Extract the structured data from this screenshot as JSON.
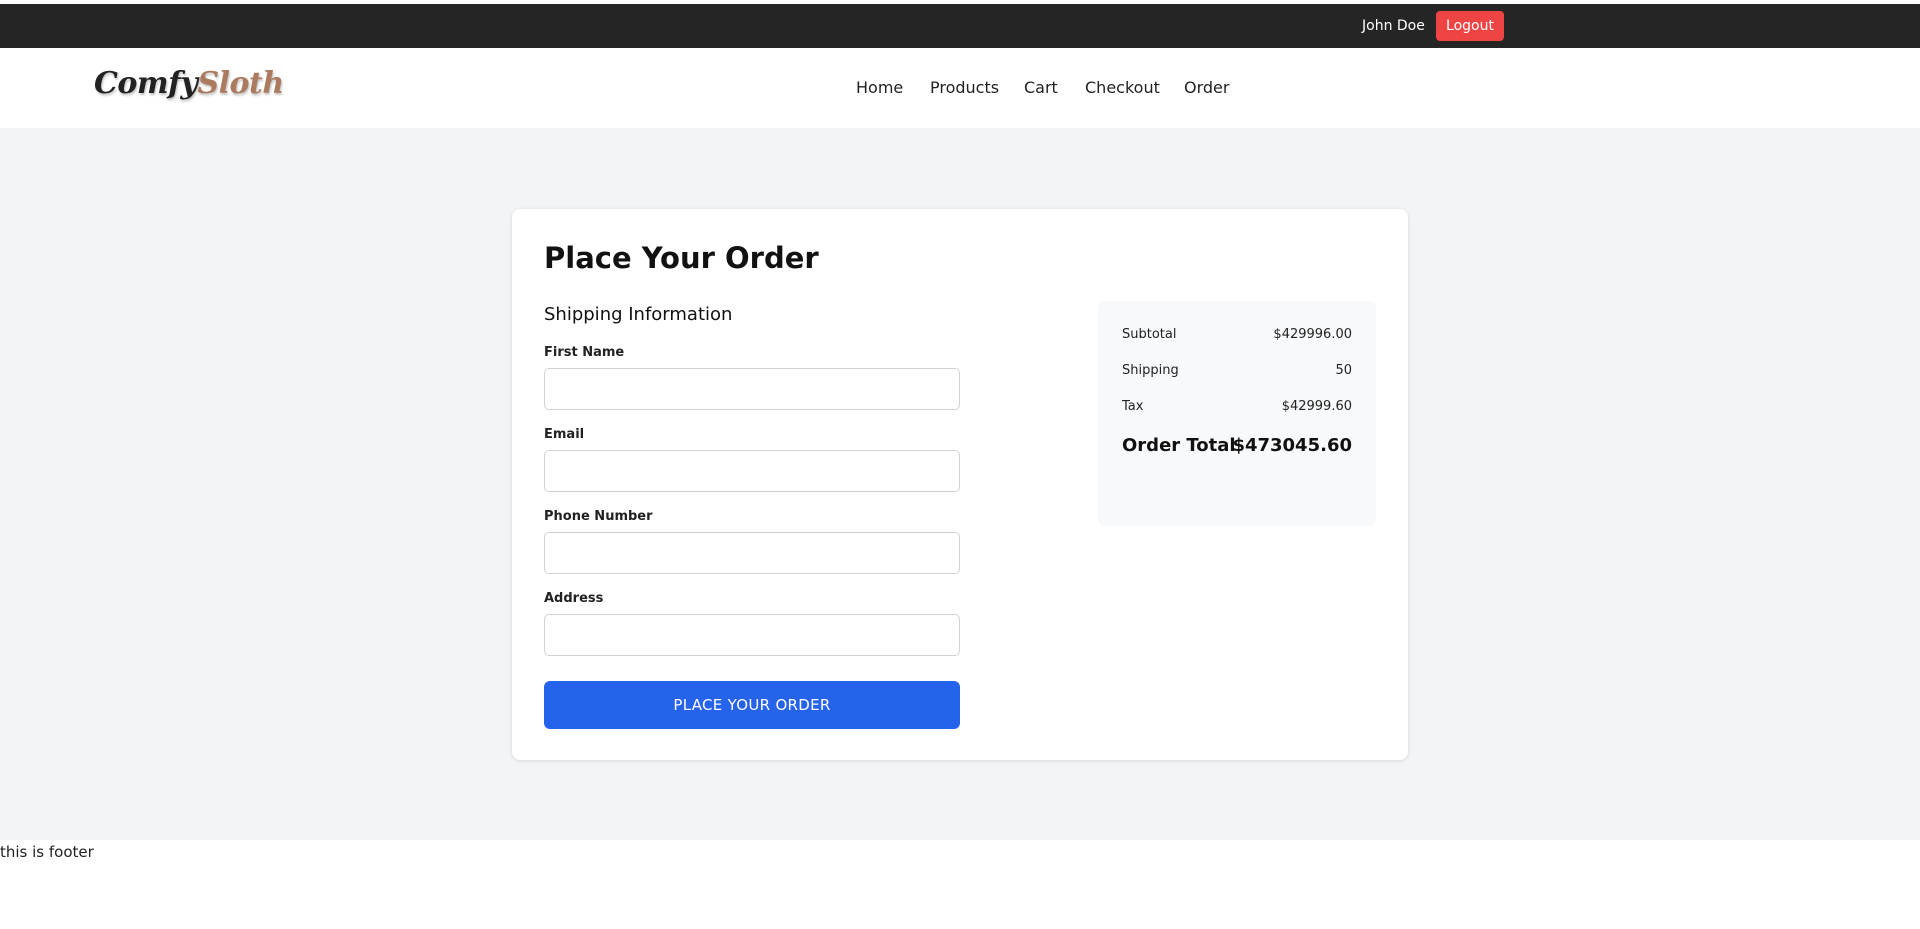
{
  "topbar": {
    "user_name": "John Doe",
    "logout_label": "Logout"
  },
  "navbar": {
    "logo_part1": "Comfy",
    "logo_part2": "Sloth",
    "links": [
      "Home",
      "Products",
      "Cart",
      "Checkout",
      "Order"
    ]
  },
  "checkout": {
    "title": "Place Your Order",
    "section_title": "Shipping Information",
    "fields": [
      {
        "label": "First Name",
        "value": ""
      },
      {
        "label": "Email",
        "value": ""
      },
      {
        "label": "Phone Number",
        "value": ""
      },
      {
        "label": "Address",
        "value": ""
      }
    ],
    "submit_label": "PLACE YOUR ORDER"
  },
  "summary": {
    "subtotal_label": "Subtotal",
    "subtotal_value": "$429996.00",
    "shipping_label": "Shipping",
    "shipping_value": "50",
    "tax_label": "Tax",
    "tax_value": "$42999.60",
    "total_label": "Order Total",
    "total_value": "$473045.60"
  },
  "footer": {
    "text": "this is footer"
  },
  "colors": {
    "topbar_bg": "#252525",
    "logout_bg": "#ef4444",
    "primary_button": "#2563eb",
    "logo_accent": "#ab7a5f",
    "page_bg": "#f3f4f6"
  }
}
